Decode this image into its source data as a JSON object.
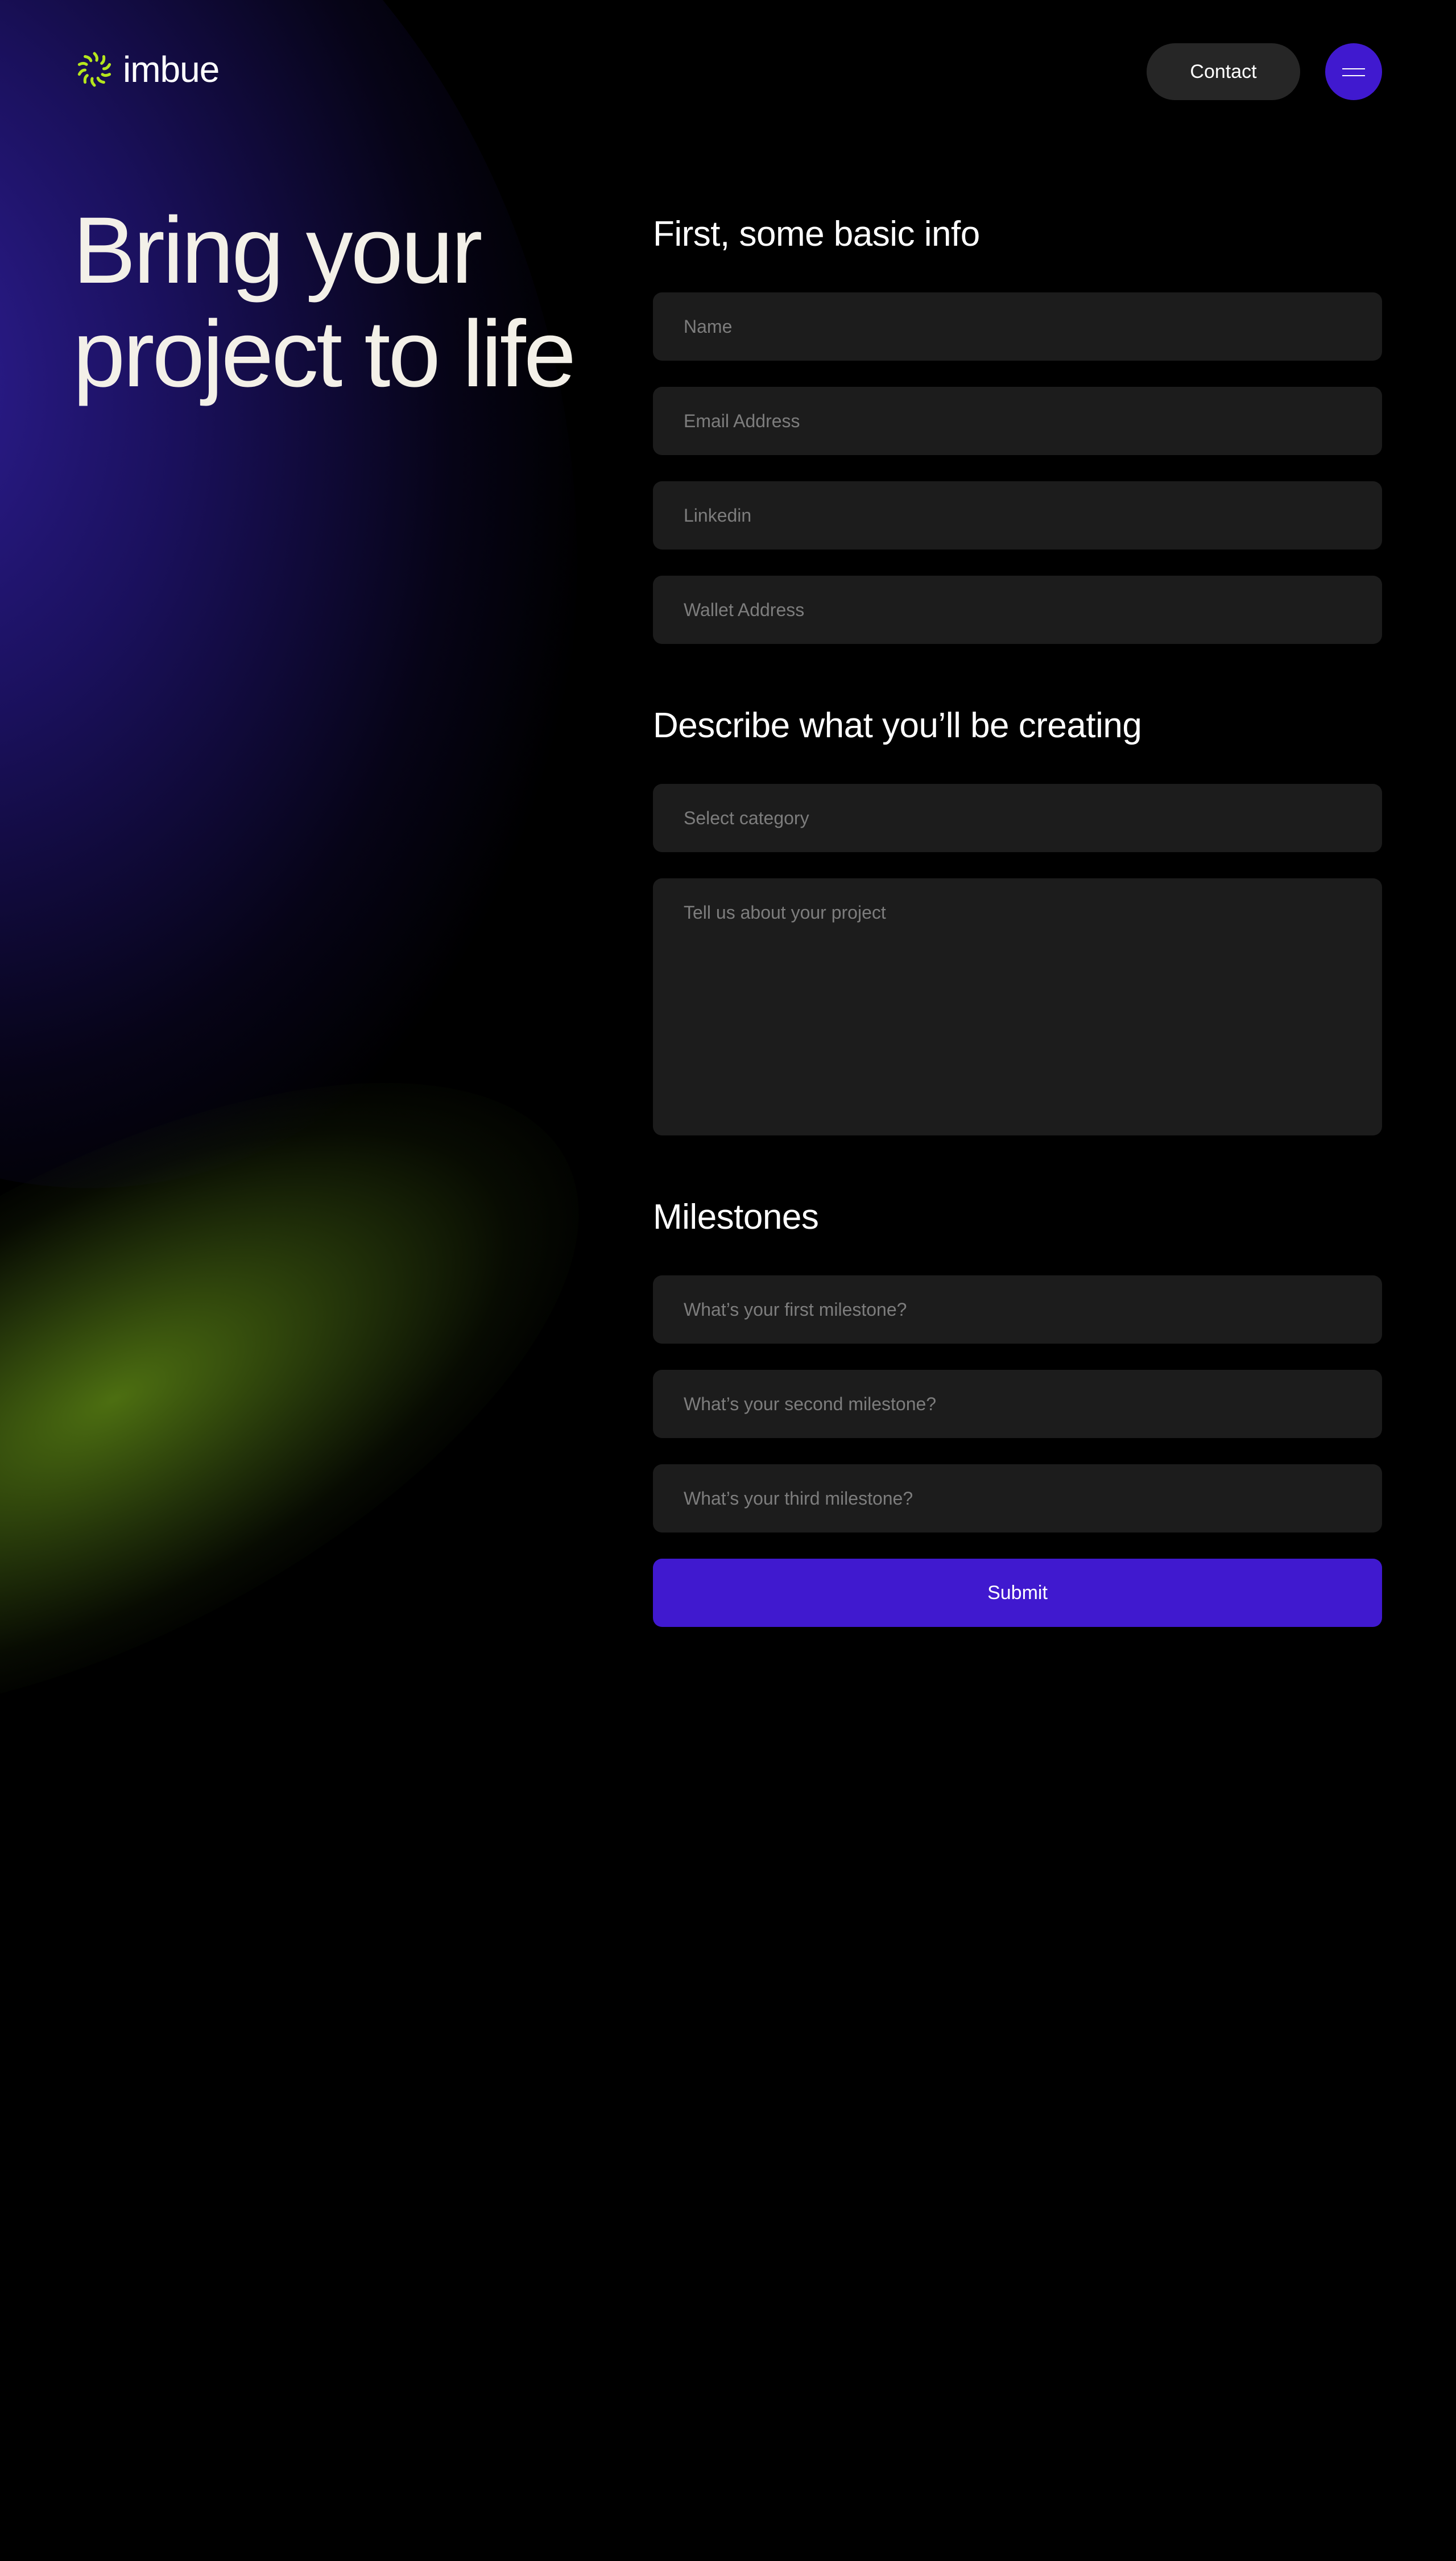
{
  "brand": {
    "name": "imbue",
    "logo_icon": "sunburst-logo-icon",
    "logo_color": "#b5e61d"
  },
  "header": {
    "contact_label": "Contact",
    "menu_icon": "hamburger-menu-icon"
  },
  "hero": {
    "title": "Bring your project to life"
  },
  "colors": {
    "accent": "#4019cf",
    "field_bg": "#1c1c1c",
    "background": "#000000"
  },
  "form": {
    "basic_info": {
      "title": "First, some basic info",
      "fields": [
        {
          "placeholder": "Name"
        },
        {
          "placeholder": "Email Address"
        },
        {
          "placeholder": "Linkedin"
        },
        {
          "placeholder": "Wallet Address"
        }
      ]
    },
    "describe": {
      "title": "Describe what you’ll be creating",
      "category_placeholder": "Select category",
      "project_placeholder": "Tell us about your project"
    },
    "milestones": {
      "title": "Milestones",
      "fields": [
        {
          "placeholder": "What’s your first milestone?"
        },
        {
          "placeholder": "What’s your second milestone?"
        },
        {
          "placeholder": "What’s your third milestone?"
        }
      ]
    },
    "submit_label": "Submit"
  }
}
